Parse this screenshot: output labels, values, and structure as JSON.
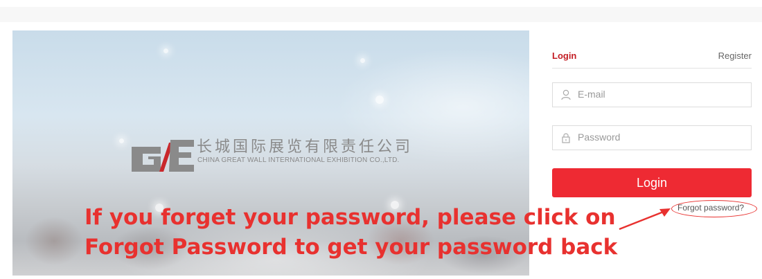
{
  "brand": {
    "name_cn": "长城国际展览有限责任公司",
    "name_en": "CHINA GREAT WALL INTERNATIONAL EXHIBITION CO.,LTD."
  },
  "login_panel": {
    "tab_login": "Login",
    "tab_register": "Register",
    "email_placeholder": "E-mail",
    "password_placeholder": "Password",
    "login_button": "Login",
    "forgot_link": "Forgot password?",
    "email_icon": "user-icon",
    "password_icon": "lock-icon"
  },
  "annotation": {
    "line1": "If you forget your password, please click on",
    "line2": "Forgot Password to get your password back",
    "color": "#e8312f"
  },
  "colors": {
    "accent": "#ee2a33",
    "tab_active": "#c31d24"
  }
}
